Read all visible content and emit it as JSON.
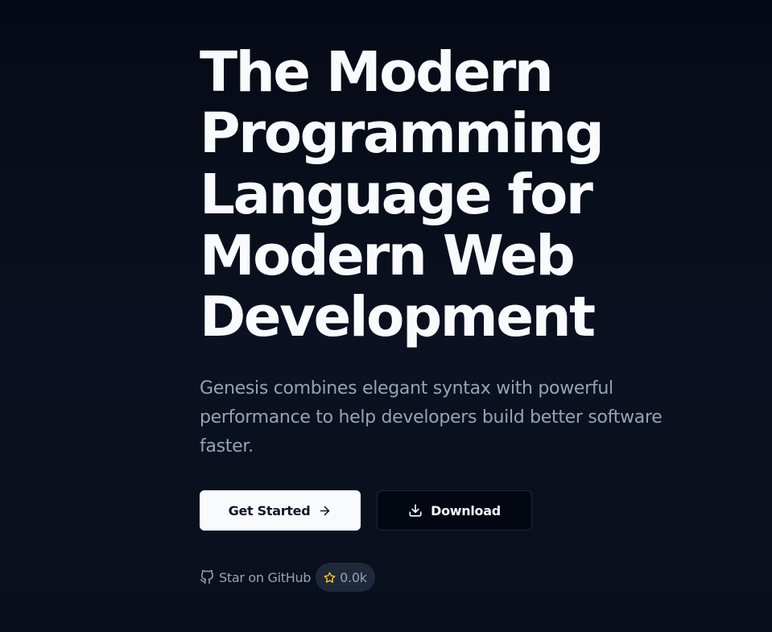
{
  "hero": {
    "title": "The Modern Programming Language for Modern Web Development",
    "subtitle": "Genesis combines elegant syntax with powerful performance to help developers build better software faster."
  },
  "actions": {
    "get_started_label": "Get Started",
    "get_started_icon": "arrow-right-icon",
    "download_label": "Download",
    "download_icon": "download-icon"
  },
  "github": {
    "label": "Star on GitHub",
    "icon": "github-icon",
    "star_icon": "star-icon",
    "star_count": "0.0k"
  },
  "colors": {
    "background": "#0b1120",
    "primary_button_bg": "#f8fafc",
    "secondary_button_bg": "#030712",
    "muted_text": "#94a3b8",
    "star_accent": "#facc15",
    "badge_bg": "#1e293b"
  }
}
